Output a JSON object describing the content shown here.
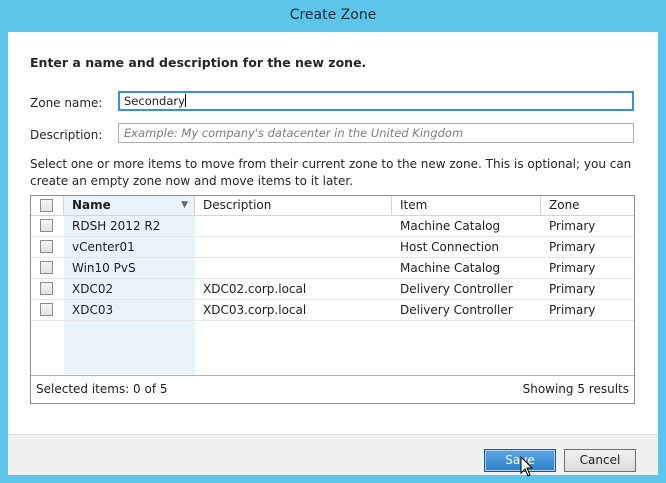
{
  "window": {
    "title": "Create Zone"
  },
  "heading": "Enter a name and description for the new zone.",
  "zone_name": {
    "label": "Zone name:",
    "value": "Secondary"
  },
  "description": {
    "label": "Description:",
    "placeholder": "Example: My company's datacenter in the United Kingdom"
  },
  "hint": "Select one or more items to move from their current zone to the new zone. This is optional; you can create an empty zone now and move items to it later.",
  "grid": {
    "columns": {
      "name": "Name",
      "description": "Description",
      "item": "Item",
      "zone": "Zone"
    },
    "rows": [
      {
        "name": "RDSH 2012 R2",
        "description": "",
        "item": "Machine Catalog",
        "zone": "Primary"
      },
      {
        "name": "vCenter01",
        "description": "",
        "item": "Host Connection",
        "zone": "Primary"
      },
      {
        "name": "Win10 PvS",
        "description": "",
        "item": "Machine Catalog",
        "zone": "Primary"
      },
      {
        "name": "XDC02",
        "description": "XDC02.corp.local",
        "item": "Delivery Controller",
        "zone": "Primary"
      },
      {
        "name": "XDC03",
        "description": "XDC03.corp.local",
        "item": "Delivery Controller",
        "zone": "Primary"
      }
    ],
    "footer": {
      "selected": "Selected items: 0 of 5",
      "results": "Showing 5 results"
    }
  },
  "buttons": {
    "save": "Save",
    "cancel": "Cancel"
  },
  "colors": {
    "titlebar": "#5ec5ea",
    "primary_button": "#2f7fc7",
    "sorted_column": "#e8f3fc"
  }
}
